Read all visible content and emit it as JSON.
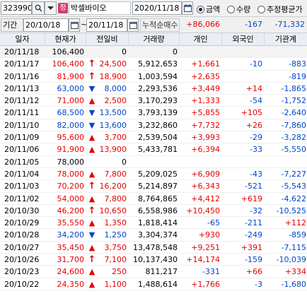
{
  "toolbar": {
    "stock_code": "323990",
    "stock_badge": "정",
    "stock_name": "박셀바이오",
    "date": "2020/11/18",
    "radio_options": [
      {
        "label": "금액",
        "selected": true
      },
      {
        "label": "수량",
        "selected": false
      },
      {
        "label": "추정평균가",
        "selected": false
      }
    ]
  },
  "period": {
    "label": "기간",
    "from": "20/10/18",
    "tilde": "~",
    "to": "20/11/18",
    "accum_label": "누적순매수",
    "sum_individual": "+86,066",
    "sum_foreign": "-167",
    "sum_institution": "-71,332"
  },
  "table": {
    "headers": [
      "일자",
      "현재가",
      "전일비",
      "거래량",
      "개인",
      "외국인",
      "기관계"
    ],
    "rows": [
      {
        "date": "20/11/18",
        "price": "106,400",
        "dir": "none",
        "change": "0",
        "volume": "0",
        "individual": "",
        "foreign": "",
        "institution": ""
      },
      {
        "date": "20/11/17",
        "price": "106,400",
        "dir": "up-arrow",
        "change": "24,500",
        "volume": "5,912,653",
        "individual": "+1,661",
        "foreign": "-10",
        "institution": "-883"
      },
      {
        "date": "20/11/16",
        "price": "81,900",
        "dir": "up-arrow",
        "change": "18,900",
        "volume": "1,003,594",
        "individual": "+2,635",
        "foreign": "",
        "institution": "-819"
      },
      {
        "date": "20/11/13",
        "price": "63,000",
        "dir": "down",
        "change": "8,000",
        "volume": "2,293,536",
        "individual": "+3,449",
        "foreign": "+14",
        "institution": "-1,865"
      },
      {
        "date": "20/11/12",
        "price": "71,000",
        "dir": "up",
        "change": "2,500",
        "volume": "3,170,293",
        "individual": "+1,333",
        "foreign": "-54",
        "institution": "-1,752"
      },
      {
        "date": "20/11/11",
        "price": "68,500",
        "dir": "down",
        "change": "13,500",
        "volume": "3,793,139",
        "individual": "+5,855",
        "foreign": "+105",
        "institution": "-2,640"
      },
      {
        "date": "20/11/10",
        "price": "82,000",
        "dir": "down",
        "change": "13,600",
        "volume": "3,232,860",
        "individual": "+7,732",
        "foreign": "+26",
        "institution": "-7,860"
      },
      {
        "date": "20/11/09",
        "price": "95,600",
        "dir": "up",
        "change": "3,700",
        "volume": "2,539,504",
        "individual": "+3,993",
        "foreign": "-29",
        "institution": "-3,282"
      },
      {
        "date": "20/11/06",
        "price": "91,900",
        "dir": "up",
        "change": "13,900",
        "volume": "5,433,781",
        "individual": "+6,394",
        "foreign": "-33",
        "institution": "-5,550"
      },
      {
        "date": "20/11/05",
        "price": "78,000",
        "dir": "none",
        "change": "0",
        "volume": "",
        "individual": "",
        "foreign": "",
        "institution": ""
      },
      {
        "date": "20/11/04",
        "price": "78,000",
        "dir": "up",
        "change": "7,800",
        "volume": "5,209,025",
        "individual": "+6,909",
        "foreign": "-43",
        "institution": "-7,227"
      },
      {
        "date": "20/11/03",
        "price": "70,200",
        "dir": "up-arrow",
        "change": "16,200",
        "volume": "5,214,897",
        "individual": "+6,343",
        "foreign": "-521",
        "institution": "-5,543"
      },
      {
        "date": "20/11/02",
        "price": "54,000",
        "dir": "up",
        "change": "7,800",
        "volume": "8,764,865",
        "individual": "+4,412",
        "foreign": "+619",
        "institution": "-4,622"
      },
      {
        "date": "20/10/30",
        "price": "46,200",
        "dir": "up-arrow",
        "change": "10,650",
        "volume": "6,558,986",
        "individual": "+10,450",
        "foreign": "-32",
        "institution": "-10,525"
      },
      {
        "date": "20/10/29",
        "price": "35,550",
        "dir": "up",
        "change": "1,350",
        "volume": "1,818,414",
        "individual": "-65",
        "foreign": "-211",
        "institution": "+112"
      },
      {
        "date": "20/10/28",
        "price": "34,200",
        "dir": "down",
        "change": "1,250",
        "volume": "3,304,374",
        "individual": "+930",
        "foreign": "-249",
        "institution": "-859"
      },
      {
        "date": "20/10/27",
        "price": "35,450",
        "dir": "up",
        "change": "3,750",
        "volume": "13,478,548",
        "individual": "+9,251",
        "foreign": "+391",
        "institution": "-7,115"
      },
      {
        "date": "20/10/26",
        "price": "31,700",
        "dir": "up-arrow",
        "change": "7,100",
        "volume": "10,137,430",
        "individual": "+14,174",
        "foreign": "-159",
        "institution": "-10,039"
      },
      {
        "date": "20/10/23",
        "price": "24,600",
        "dir": "up",
        "change": "250",
        "volume": "811,217",
        "individual": "-331",
        "foreign": "+66",
        "institution": "+334"
      },
      {
        "date": "20/10/22",
        "price": "24,350",
        "dir": "up",
        "change": "1,100",
        "volume": "1,488,614",
        "individual": "+1,766",
        "foreign": "-3",
        "institution": "-1,680"
      }
    ]
  },
  "colors": {
    "up": "#e60000",
    "down": "#0044cc",
    "header_bg": "#e9eef4"
  }
}
